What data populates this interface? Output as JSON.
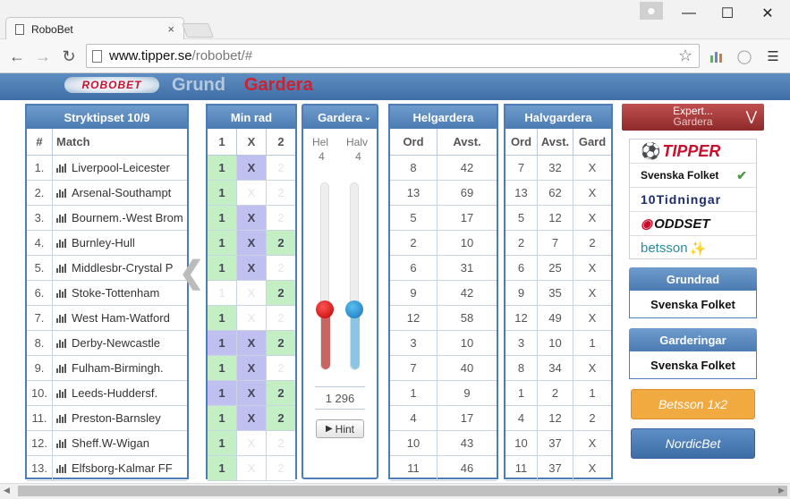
{
  "browser": {
    "tab_title": "RoboBet",
    "tab_close": "×",
    "url_host": "www.tipper.se",
    "url_path": "/robobet/#"
  },
  "app": {
    "logo": "ROBOBET",
    "nav_grund": "Grund",
    "nav_gardera": "Gardera"
  },
  "stryktipset": {
    "title": "Stryktipset 10/9",
    "col_no": "#",
    "col_match": "Match",
    "rows": [
      {
        "n": "1.",
        "match": "Liverpool-Leicester"
      },
      {
        "n": "2.",
        "match": "Arsenal-Southampt"
      },
      {
        "n": "3.",
        "match": "Bournem.-West Brom"
      },
      {
        "n": "4.",
        "match": "Burnley-Hull"
      },
      {
        "n": "5.",
        "match": "Middlesbr-Crystal P"
      },
      {
        "n": "6.",
        "match": "Stoke-Tottenham"
      },
      {
        "n": "7.",
        "match": "West Ham-Watford"
      },
      {
        "n": "8.",
        "match": "Derby-Newcastle"
      },
      {
        "n": "9.",
        "match": "Fulham-Birmingh."
      },
      {
        "n": "10.",
        "match": "Leeds-Huddersf."
      },
      {
        "n": "11.",
        "match": "Preston-Barnsley"
      },
      {
        "n": "12.",
        "match": "Sheff.W-Wigan"
      },
      {
        "n": "13.",
        "match": "Elfsborg-Kalmar FF"
      }
    ]
  },
  "minrad": {
    "title": "Min rad",
    "headers": [
      "1",
      "X",
      "2"
    ],
    "rows": [
      {
        "s": [
          1,
          1,
          0
        ]
      },
      {
        "s": [
          1,
          0,
          0
        ]
      },
      {
        "s": [
          1,
          1,
          0
        ]
      },
      {
        "s": [
          1,
          1,
          1
        ]
      },
      {
        "s": [
          1,
          1,
          0
        ]
      },
      {
        "s": [
          0,
          0,
          1
        ]
      },
      {
        "s": [
          1,
          0,
          0
        ]
      },
      {
        "s": [
          2,
          1,
          1
        ]
      },
      {
        "s": [
          1,
          1,
          0
        ]
      },
      {
        "s": [
          2,
          1,
          1
        ]
      },
      {
        "s": [
          1,
          1,
          1
        ]
      },
      {
        "s": [
          1,
          0,
          0
        ]
      },
      {
        "s": [
          1,
          0,
          0
        ]
      }
    ]
  },
  "gardera": {
    "title": "Gardera",
    "hel_label": "Hel",
    "halv_label": "Halv",
    "hel_value": "4",
    "halv_value": "4",
    "hel_level": 0.33,
    "halv_level": 0.33,
    "rows_count": "1 296",
    "hint_label": "Hint"
  },
  "helgardera": {
    "title": "Helgardera",
    "col_ord": "Ord",
    "col_avst": "Avst.",
    "rows": [
      [
        "8",
        "42"
      ],
      [
        "13",
        "69"
      ],
      [
        "5",
        "17"
      ],
      [
        "2",
        "10"
      ],
      [
        "6",
        "31"
      ],
      [
        "9",
        "42"
      ],
      [
        "12",
        "58"
      ],
      [
        "3",
        "10"
      ],
      [
        "7",
        "40"
      ],
      [
        "1",
        "9"
      ],
      [
        "4",
        "17"
      ],
      [
        "10",
        "43"
      ],
      [
        "11",
        "46"
      ]
    ]
  },
  "halvgardera": {
    "title": "Halvgardera",
    "col_ord": "Ord",
    "col_avst": "Avst.",
    "col_gard": "Gard",
    "rows": [
      [
        "7",
        "32",
        "X"
      ],
      [
        "13",
        "62",
        "X"
      ],
      [
        "5",
        "12",
        "X"
      ],
      [
        "2",
        "7",
        "2"
      ],
      [
        "6",
        "25",
        "X"
      ],
      [
        "9",
        "35",
        "X"
      ],
      [
        "12",
        "49",
        "X"
      ],
      [
        "3",
        "10",
        "1"
      ],
      [
        "8",
        "34",
        "X"
      ],
      [
        "1",
        "2",
        "1"
      ],
      [
        "4",
        "12",
        "2"
      ],
      [
        "10",
        "37",
        "X"
      ],
      [
        "11",
        "37",
        "X"
      ]
    ]
  },
  "side": {
    "expert_line1": "Expert...",
    "expert_line2": "Gardera",
    "sources": [
      "TIPPER",
      "Svenska Folket",
      "10Tidningar",
      "ODDSET",
      "betsson"
    ],
    "selected_source": "Svenska Folket",
    "grundrad_label": "Grundrad",
    "grundrad_value": "Svenska Folket",
    "garderingar_label": "Garderingar",
    "garderingar_value": "Svenska Folket",
    "betsson_button": "Betsson 1x2",
    "nordicbet_button": "NordicBet",
    "colors": {
      "betsson": "#f0aa40",
      "nordicbet": "#4a7bb5",
      "accent": "#d0202e"
    }
  }
}
